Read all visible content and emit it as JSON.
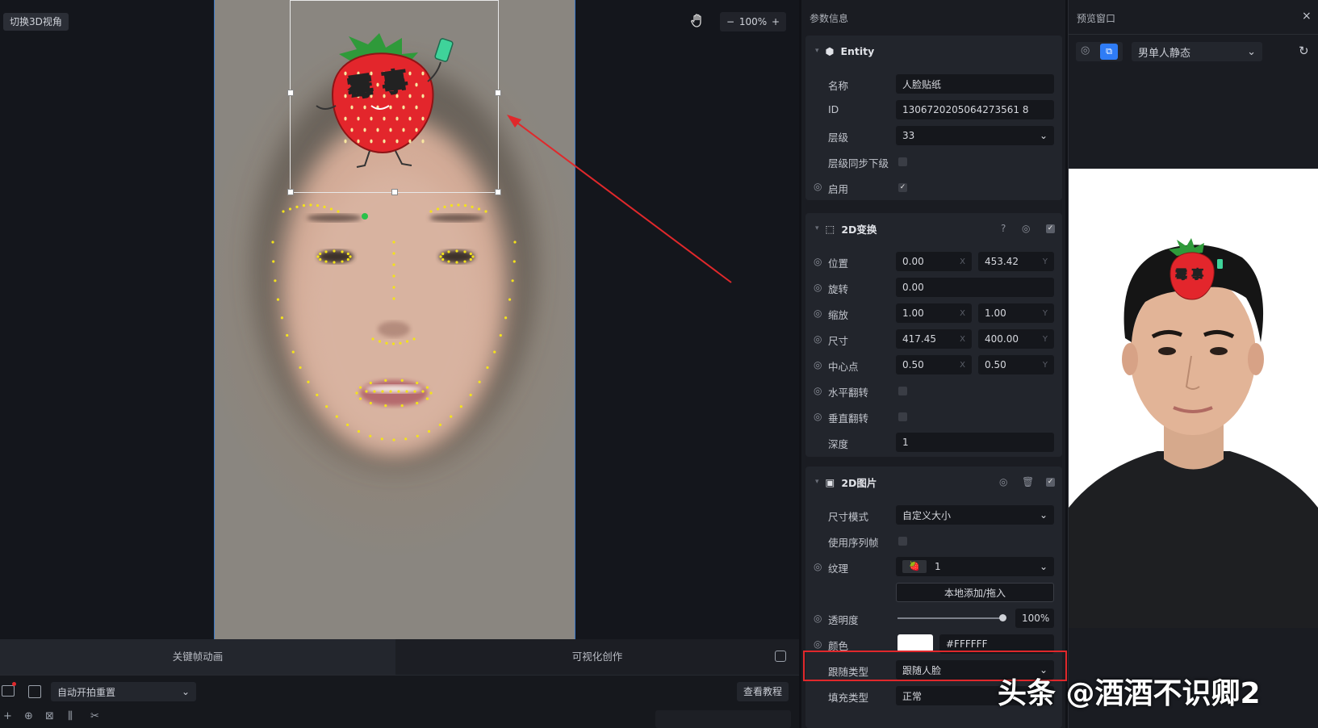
{
  "viewport": {
    "switch3d_label": "切换3D视角",
    "zoom_minus": "−",
    "zoom_value": "100%",
    "zoom_plus": "+",
    "sticker_text": "霉 事"
  },
  "bottom": {
    "tab_keyframe": "关键帧动画",
    "tab_visual": "可视化创作",
    "auto_reset_select": "自动开拍重置",
    "tutorial_label": "查看教程"
  },
  "params": {
    "title": "参数信息",
    "entity": {
      "header": "Entity",
      "name_label": "名称",
      "name_value": "人脸贴纸",
      "id_label": "ID",
      "id_value": "1306720205064273561 8",
      "layer_label": "层级",
      "layer_value": "33",
      "layer_sync_label": "层级同步下级",
      "enable_label": "启用"
    },
    "transform2d": {
      "header": "2D变换",
      "position_label": "位置",
      "position_x": "0.00",
      "position_y": "453.42",
      "rotation_label": "旋转",
      "rotation_value": "0.00",
      "scale_label": "缩放",
      "scale_x": "1.00",
      "scale_y": "1.00",
      "size_label": "尺寸",
      "size_x": "417.45",
      "size_y": "400.00",
      "pivot_label": "中心点",
      "pivot_x": "0.50",
      "pivot_y": "0.50",
      "hflip_label": "水平翻转",
      "vflip_label": "垂直翻转",
      "depth_label": "深度",
      "depth_value": "1",
      "axis_x": "X",
      "axis_y": "Y"
    },
    "image2d": {
      "header": "2D图片",
      "size_mode_label": "尺寸模式",
      "size_mode_value": "自定义大小",
      "use_sequence_label": "使用序列帧",
      "texture_label": "纹理",
      "texture_value": "1",
      "local_add_label": "本地添加/拖入",
      "opacity_label": "透明度",
      "opacity_value": "100%",
      "color_label": "颜色",
      "color_value": "#FFFFFF",
      "follow_type_label": "跟随类型",
      "follow_type_value": "跟随人脸",
      "fill_type_label": "填充类型",
      "fill_type_value": "正常"
    }
  },
  "preview": {
    "title": "预览窗口",
    "close": "×",
    "model_select": "男单人静态",
    "sticker_text": "霉 事"
  },
  "watermark": "头条 @酒酒不识卿2",
  "colors": {
    "accent_blue": "#2f7cf6",
    "highlight_red": "#e0282b",
    "landmark_yellow": "#f3e21b",
    "landmark_green": "#29c24a"
  }
}
